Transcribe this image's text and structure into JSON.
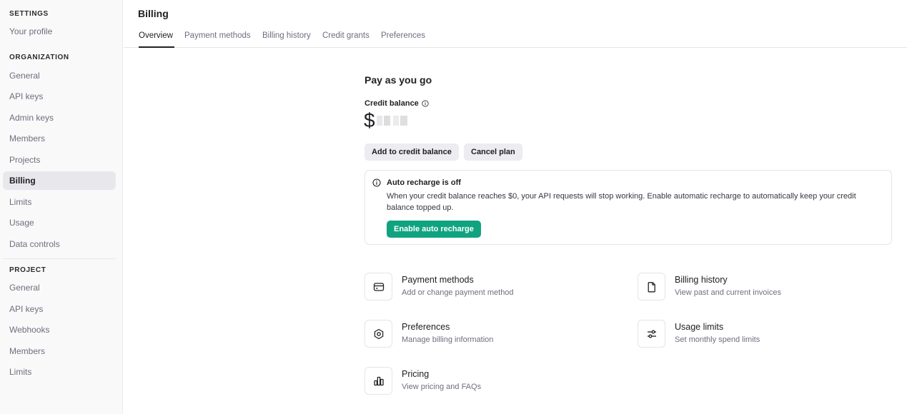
{
  "sidebar": {
    "settings_title": "SETTINGS",
    "settings_items": [
      "Your profile"
    ],
    "organization_title": "ORGANIZATION",
    "organization_items": [
      "General",
      "API keys",
      "Admin keys",
      "Members",
      "Projects",
      "Billing",
      "Limits",
      "Usage",
      "Data controls"
    ],
    "active_item": "Billing",
    "project_title": "PROJECT",
    "project_items": [
      "General",
      "API keys",
      "Webhooks",
      "Members",
      "Limits"
    ]
  },
  "header": {
    "title": "Billing",
    "tabs": [
      "Overview",
      "Payment methods",
      "Billing history",
      "Credit grants",
      "Preferences"
    ],
    "active_tab": "Overview"
  },
  "main": {
    "heading": "Pay as you go",
    "credit_label": "Credit balance",
    "balance_symbol": "$",
    "buttons": {
      "add_credit": "Add to credit balance",
      "cancel_plan": "Cancel plan"
    },
    "alert": {
      "title": "Auto recharge is off",
      "body": "When your credit balance reaches $0, your API requests will stop working. Enable automatic recharge to automatically keep your credit balance topped up.",
      "button": "Enable auto recharge"
    },
    "cards": [
      {
        "title": "Payment methods",
        "desc": "Add or change payment method",
        "icon": "credit-card-icon"
      },
      {
        "title": "Billing history",
        "desc": "View past and current invoices",
        "icon": "document-icon"
      },
      {
        "title": "Preferences",
        "desc": "Manage billing information",
        "icon": "gear-icon"
      },
      {
        "title": "Usage limits",
        "desc": "Set monthly spend limits",
        "icon": "sliders-icon"
      },
      {
        "title": "Pricing",
        "desc": "View pricing and FAQs",
        "icon": "bar-chart-icon"
      }
    ]
  },
  "colors": {
    "accent_green": "#10a37f",
    "sidebar_bg": "#f9f9f9",
    "active_nav_bg": "#e8e8ec"
  }
}
